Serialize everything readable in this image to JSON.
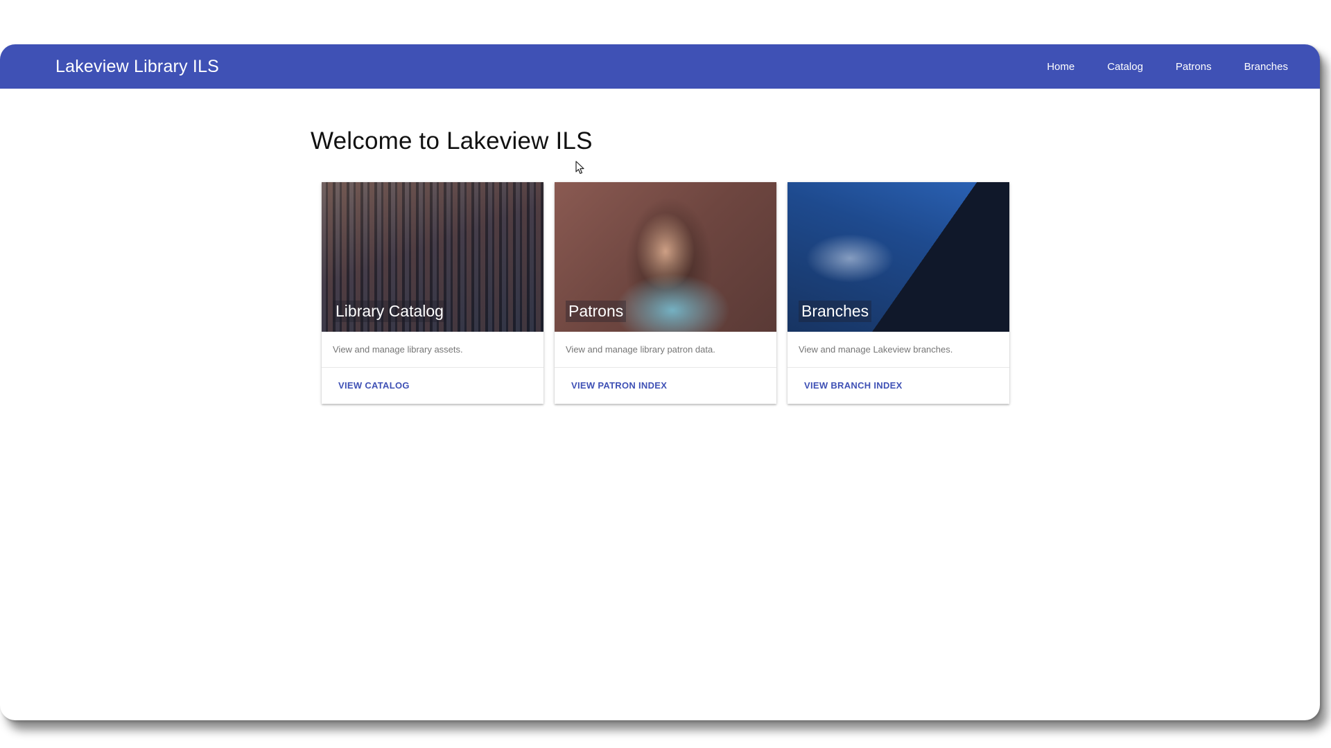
{
  "app": {
    "brand": "Lakeview Library ILS"
  },
  "nav": {
    "items": [
      {
        "label": "Home"
      },
      {
        "label": "Catalog"
      },
      {
        "label": "Patrons"
      },
      {
        "label": "Branches"
      }
    ]
  },
  "main": {
    "title": "Welcome to Lakeview ILS",
    "cards": [
      {
        "title": "Library Catalog",
        "description": "View and manage library assets.",
        "action": "VIEW CATALOG"
      },
      {
        "title": "Patrons",
        "description": "View and manage library patron data.",
        "action": "VIEW PATRON INDEX"
      },
      {
        "title": "Branches",
        "description": "View and manage Lakeview branches.",
        "action": "VIEW BRANCH INDEX"
      }
    ]
  },
  "colors": {
    "primary": "#3f51b5",
    "nav_text": "#ffffff",
    "card_text": "#757575"
  }
}
